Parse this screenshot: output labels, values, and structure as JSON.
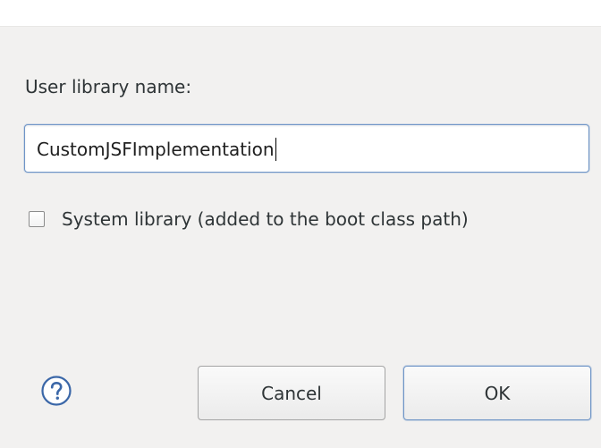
{
  "form": {
    "name_label": "User library name:",
    "name_value": "CustomJSFImplementation",
    "system_library_label": "System library (added to the boot class path)",
    "system_library_checked": false
  },
  "buttons": {
    "help_icon": "help-circle-icon",
    "cancel_label": "Cancel",
    "ok_label": "OK"
  },
  "colors": {
    "dialog_background": "#f2f1f0",
    "focus_border": "#6f95c7",
    "help_icon": "#3b67a8"
  }
}
